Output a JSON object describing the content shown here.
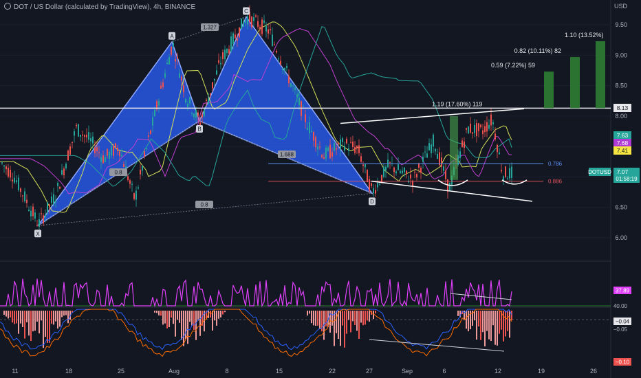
{
  "header": {
    "title": "DOT / US Dollar (calculated by TradingView), 4h, BINANCE",
    "currency": "USD"
  },
  "chart_data": {
    "type": "candlestick",
    "symbol": "DOTUSD",
    "exchange": "BINANCE",
    "interval": "4h",
    "y_ticks": [
      "9.50",
      "9.00",
      "8.50",
      "8.00",
      "7.50",
      "7.00",
      "6.50",
      "6.00"
    ],
    "x_ticks": [
      "11",
      "18",
      "25",
      "Aug",
      "8",
      "15",
      "22",
      "27",
      "Sep",
      "6",
      "12",
      "19",
      "26"
    ],
    "harmonic_points": [
      {
        "label": "X",
        "price": 6.2
      },
      {
        "label": "A",
        "price": 9.22
      },
      {
        "label": "B",
        "price": 7.92
      },
      {
        "label": "C",
        "price": 9.63
      },
      {
        "label": "D",
        "price": 6.73
      }
    ],
    "ratio_labels": [
      "1.327",
      "0.8",
      "1.688",
      "0.8"
    ],
    "fib_levels": [
      {
        "label": "0.786",
        "price": 7.22,
        "color": "#5b8def"
      },
      {
        "label": "0.886",
        "price": 6.93,
        "color": "#e0525b"
      }
    ],
    "targets": [
      {
        "label": "1.19 (17.60%) 119",
        "price": 8.13
      },
      {
        "label": "0.59 (7.22%) 59",
        "price": 8.73
      },
      {
        "label": "0.82 (10.11%) 82",
        "price": 8.97
      },
      {
        "label": "1.10 (13.52%)",
        "price": 9.23
      }
    ],
    "price_badges": [
      {
        "label": "8.13",
        "color": "#e8e8ec",
        "text_color": "#131722"
      },
      {
        "label": "7.63",
        "color": "#26a69a",
        "text_color": "#ffffff"
      },
      {
        "label": "7.68",
        "color": "#b03ad6",
        "text_color": "#ffffff"
      },
      {
        "label": "7.41",
        "color": "#f5e642",
        "text_color": "#131722"
      }
    ],
    "last_price": {
      "symbol": "DOTUSD",
      "price": "7.07",
      "countdown": "01:58:19",
      "color": "#26a69a"
    },
    "rsi": {
      "levels": [
        "40.00",
        "30.00"
      ],
      "current": "37.89"
    },
    "macd": {
      "current": "−0.04",
      "ticks": [
        "−0.05"
      ],
      "min": "−0.10"
    }
  }
}
